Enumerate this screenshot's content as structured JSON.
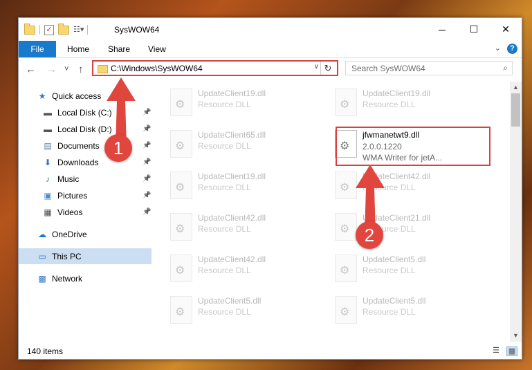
{
  "window": {
    "title": "SysWOW64",
    "minimize": "─",
    "maximize": "☐",
    "close": "✕"
  },
  "ribbon": {
    "tabs": [
      "File",
      "Home",
      "Share",
      "View"
    ],
    "expand": "⌄",
    "help": "?"
  },
  "nav": {
    "back": "←",
    "forward": "→",
    "recent": "˅",
    "up": "↑",
    "address": "C:\\Windows\\SysWOW64",
    "address_dropdown": "∨",
    "refresh": "↻",
    "search_placeholder": "Search SysWOW64",
    "search_icon": "⌕"
  },
  "sidebar": {
    "items": [
      {
        "label": "Quick access",
        "icon": "star-icon",
        "glyph": "★",
        "color": "#2b79c8",
        "pinned": false
      },
      {
        "label": "Local Disk (C:)",
        "icon": "drive-icon",
        "glyph": "▬",
        "color": "#555555",
        "pinned": true
      },
      {
        "label": "Local Disk (D:)",
        "icon": "drive-icon",
        "glyph": "▬",
        "color": "#555555",
        "pinned": true
      },
      {
        "label": "Documents",
        "icon": "documents-icon",
        "glyph": "▤",
        "color": "#5a7fa8",
        "pinned": true
      },
      {
        "label": "Downloads",
        "icon": "downloads-icon",
        "glyph": "⬇",
        "color": "#2b79c8",
        "pinned": true
      },
      {
        "label": "Music",
        "icon": "music-icon",
        "glyph": "♪",
        "color": "#2b79c8",
        "pinned": true
      },
      {
        "label": "Pictures",
        "icon": "pictures-icon",
        "glyph": "▣",
        "color": "#4b8bc8",
        "pinned": true
      },
      {
        "label": "Videos",
        "icon": "videos-icon",
        "glyph": "▦",
        "color": "#444444",
        "pinned": true
      },
      {
        "label": "OneDrive",
        "icon": "onedrive-icon",
        "glyph": "☁",
        "color": "#1979ca",
        "pinned": false
      },
      {
        "label": "This PC",
        "icon": "computer-icon",
        "glyph": "▭",
        "color": "#2b79c8",
        "pinned": false
      },
      {
        "label": "Network",
        "icon": "network-icon",
        "glyph": "▩",
        "color": "#2b79c8",
        "pinned": false
      }
    ],
    "pin_glyph": "📌"
  },
  "files": [
    {
      "name": "UpdateClient19.dll",
      "desc": "Resource DLL"
    },
    {
      "name": "UpdateClient19.dll",
      "desc": "Resource DLL"
    },
    {
      "name": "UpdateClient65.dll",
      "desc": "Resource DLL"
    },
    {
      "name": "jfwmanetwt9.dll",
      "version": "2.0.0.1220",
      "desc": "WMA Writer for jetA...",
      "highlight": true
    },
    {
      "name": "UpdateClient19.dll",
      "desc": "Resource DLL"
    },
    {
      "name": "UpdateClient42.dll",
      "desc": "Resource DLL"
    },
    {
      "name": "UpdateClient42.dll",
      "desc": "Resource DLL"
    },
    {
      "name": "UpdateClient21.dll",
      "desc": "Resource DLL"
    },
    {
      "name": "UpdateClient42.dll",
      "desc": "Resource DLL"
    },
    {
      "name": "UpdateClient5.dll",
      "desc": "Resource DLL"
    },
    {
      "name": "UpdateClient5.dll",
      "desc": "Resource DLL"
    },
    {
      "name": "UpdateClient5.dll",
      "desc": "Resource DLL"
    }
  ],
  "scroll": {
    "up": "▲",
    "down": "▼"
  },
  "status": {
    "item_count": "140 items",
    "details_view": "☰",
    "icons_view": "▦"
  },
  "annotations": {
    "step1": "1",
    "step2": "2",
    "color": "#d9403f"
  }
}
